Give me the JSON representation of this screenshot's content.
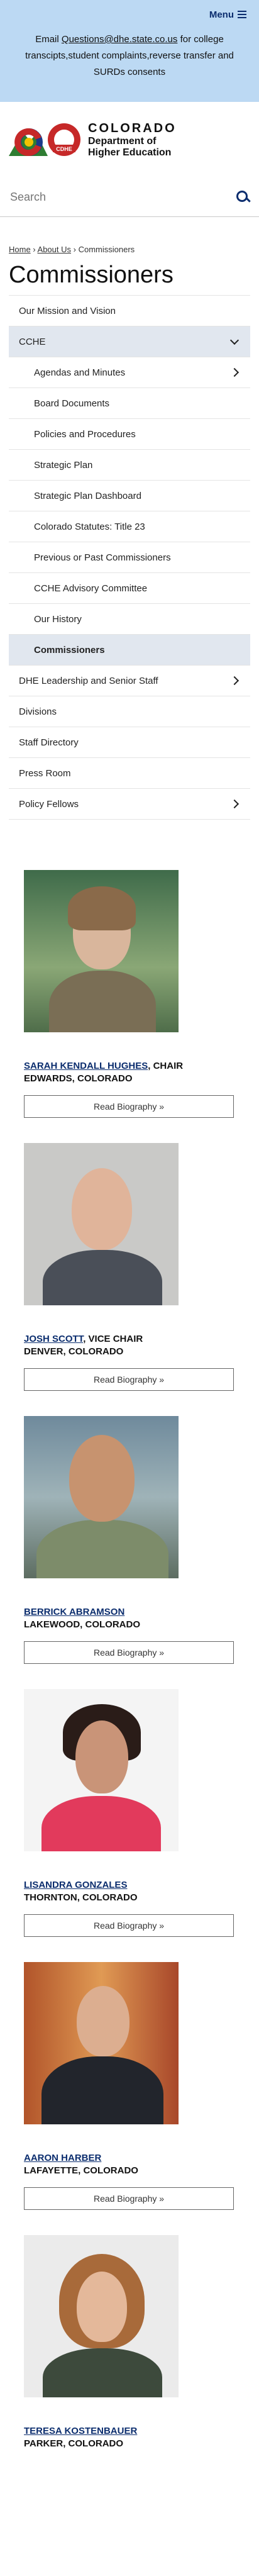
{
  "header": {
    "menu_label": "Menu",
    "notice_before": "Email ",
    "notice_email": "Questions@dhe.state.co.us",
    "notice_after": " for college transcipts,student complaints,reverse transfer and SURDs consents"
  },
  "logo": {
    "title": "COLORADO",
    "line1": "Department of",
    "line2": "Higher Education",
    "seal_text": "CDHE"
  },
  "search": {
    "placeholder": "Search"
  },
  "breadcrumb": {
    "home": "Home",
    "about": "About Us",
    "current": "Commissioners"
  },
  "page_title": "Commissioners",
  "nav": {
    "items": [
      {
        "label": "Our Mission and Vision"
      },
      {
        "label": "CCHE"
      },
      {
        "label": "Agendas and Minutes"
      },
      {
        "label": "Board Documents"
      },
      {
        "label": "Policies and Procedures"
      },
      {
        "label": "Strategic Plan"
      },
      {
        "label": "Strategic Plan Dashboard"
      },
      {
        "label": "Colorado Statutes: Title 23"
      },
      {
        "label": "Previous or Past Commissioners"
      },
      {
        "label": "CCHE Advisory Committee"
      },
      {
        "label": "Our History"
      },
      {
        "label": "Commissioners"
      },
      {
        "label": "DHE Leadership and Senior Staff"
      },
      {
        "label": "Divisions"
      },
      {
        "label": "Staff Directory"
      },
      {
        "label": "Press Room"
      },
      {
        "label": "Policy Fellows"
      }
    ]
  },
  "people": [
    {
      "name": "SARAH KENDALL HUGHES",
      "role": ", CHAIR",
      "location": "EDWARDS, COLORADO",
      "button": "Read Biography »"
    },
    {
      "name": "JOSH SCOTT",
      "role": ", VICE CHAIR",
      "location": "DENVER, COLORADO",
      "button": "Read Biography »"
    },
    {
      "name": "BERRICK ABRAMSON",
      "role": "",
      "location": "LAKEWOOD, COLORADO",
      "button": "Read Biography »"
    },
    {
      "name": "LISANDRA GONZALES",
      "role": "",
      "location": "THORNTON, COLORADO",
      "button": "Read Biography »"
    },
    {
      "name": "AARON HARBER",
      "role": "",
      "location": "LAFAYETTE, COLORADO",
      "button": "Read Biography »"
    },
    {
      "name": "TERESA KOSTENBAUER",
      "role": "",
      "location": "PARKER, COLORADO",
      "button": ""
    }
  ]
}
